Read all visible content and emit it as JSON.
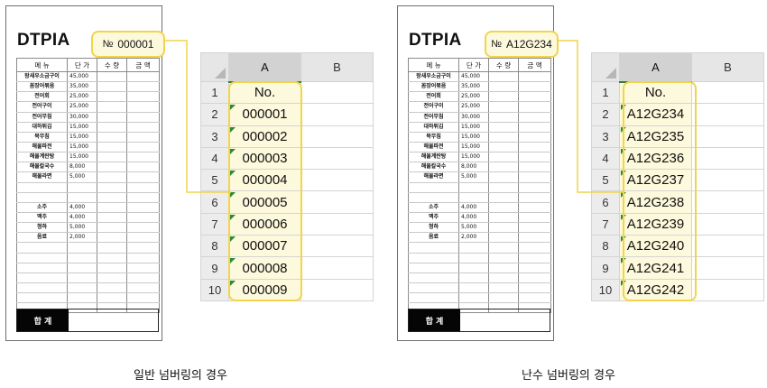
{
  "panels": [
    {
      "brand": "DTPIA",
      "tag_sign": "№",
      "tag_value": "000001",
      "menu_headers": [
        "메 뉴",
        "단 가",
        "수 량",
        "금 액"
      ],
      "menu_rows": [
        [
          "왕새우소금구이",
          "45,000"
        ],
        [
          "꼼장어볶음",
          "35,000"
        ],
        [
          "전어회",
          "25,000"
        ],
        [
          "전어구이",
          "25,000"
        ],
        [
          "전어무침",
          "30,000"
        ],
        [
          "대하튀김",
          "15,000"
        ],
        [
          "묵무침",
          "15,000"
        ],
        [
          "해물파전",
          "15,000"
        ],
        [
          "해물계란탕",
          "15,000"
        ],
        [
          "해물칼국수",
          "8,000"
        ],
        [
          "해물라면",
          "5,000"
        ],
        [
          "",
          ""
        ],
        [
          "",
          ""
        ],
        [
          "소주",
          "4,000"
        ],
        [
          "맥주",
          "4,000"
        ],
        [
          "청하",
          "5,000"
        ],
        [
          "음료",
          "2,000"
        ],
        [
          "",
          ""
        ],
        [
          "",
          ""
        ],
        [
          "",
          ""
        ],
        [
          "",
          ""
        ],
        [
          "",
          ""
        ],
        [
          "",
          ""
        ],
        [
          "",
          ""
        ]
      ],
      "total_label": "합 계",
      "col_headers": [
        "A",
        "B"
      ],
      "row_numbers": [
        "1",
        "2",
        "3",
        "4",
        "5",
        "6",
        "7",
        "8",
        "9",
        "10"
      ],
      "col_a_values": [
        "No.",
        "000001",
        "000002",
        "000003",
        "000004",
        "000005",
        "000006",
        "000007",
        "000008",
        "000009"
      ],
      "caption": "일반 넘버링의 경우"
    },
    {
      "brand": "DTPIA",
      "tag_sign": "№",
      "tag_value": "A12G234",
      "menu_headers": [
        "메 뉴",
        "단 가",
        "수 량",
        "금 액"
      ],
      "menu_rows": [
        [
          "왕새우소금구이",
          "45,000"
        ],
        [
          "꼼장어볶음",
          "35,000"
        ],
        [
          "전어회",
          "25,000"
        ],
        [
          "전어구이",
          "25,000"
        ],
        [
          "전어무침",
          "30,000"
        ],
        [
          "대하튀김",
          "15,000"
        ],
        [
          "묵무침",
          "15,000"
        ],
        [
          "해물파전",
          "15,000"
        ],
        [
          "해물계란탕",
          "15,000"
        ],
        [
          "해물칼국수",
          "8,000"
        ],
        [
          "해물라면",
          "5,000"
        ],
        [
          "",
          ""
        ],
        [
          "",
          ""
        ],
        [
          "소주",
          "4,000"
        ],
        [
          "맥주",
          "4,000"
        ],
        [
          "청하",
          "5,000"
        ],
        [
          "음료",
          "2,000"
        ],
        [
          "",
          ""
        ],
        [
          "",
          ""
        ],
        [
          "",
          ""
        ],
        [
          "",
          ""
        ],
        [
          "",
          ""
        ],
        [
          "",
          ""
        ],
        [
          "",
          ""
        ]
      ],
      "total_label": "합 계",
      "col_headers": [
        "A",
        "B"
      ],
      "row_numbers": [
        "1",
        "2",
        "3",
        "4",
        "5",
        "6",
        "7",
        "8",
        "9",
        "10"
      ],
      "col_a_values": [
        "No.",
        "A12G234",
        "A12G235",
        "A12G236",
        "A12G237",
        "A12G238",
        "A12G239",
        "A12G240",
        "A12G241",
        "A12G242"
      ],
      "caption": "난수 넘버링의 경우"
    }
  ],
  "colors": {
    "highlight": "#f2d44c",
    "highlight_fill": "#fdf9dc",
    "header_gray": "#e6e6e6",
    "selected_col_bar": "#2e7d32",
    "error_triangle": "#2c8a34"
  }
}
